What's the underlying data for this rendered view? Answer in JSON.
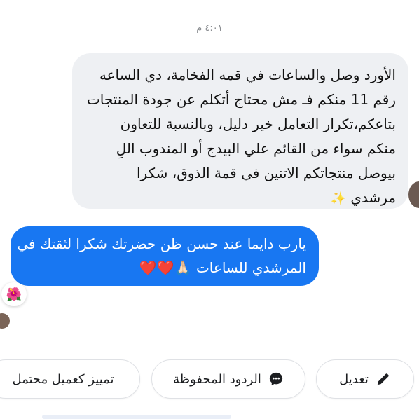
{
  "message_time": "٤:٠١ م",
  "incoming_message": {
    "lines": [
      "الأورد وصل والساعات في قمه الفخامة، دي الساعه",
      "رقم 11 منكم  فـ مش محتاج أتكلم عن جودة المنتجات",
      "بتاعكم،تكرار التعامل خير دليل، وبالنسبة للتعاون",
      "منكم  سواء من القائم علي البيدج أو المندوب اللِ",
      "بيوصل منتجاتكم  الاتنين في قمة الذوق، شكرا",
      "مرشدي"
    ],
    "emoji": "✨"
  },
  "outgoing_message": {
    "lines": [
      "يارب دايما عند حسن ظن حضرتك شكرا لثقتك في",
      "المرشدي للساعات"
    ],
    "emoji": "🙏🏻❤️❤️"
  },
  "reaction_emoji": "🌺",
  "actions": {
    "edit": "تعديل",
    "saved_replies": "الردود المحفوظة",
    "mark_customer": "تمييز كعميل محتمل"
  },
  "colors": {
    "outgoing_bubble": "#1877f2",
    "incoming_bubble": "#eef0f3"
  }
}
